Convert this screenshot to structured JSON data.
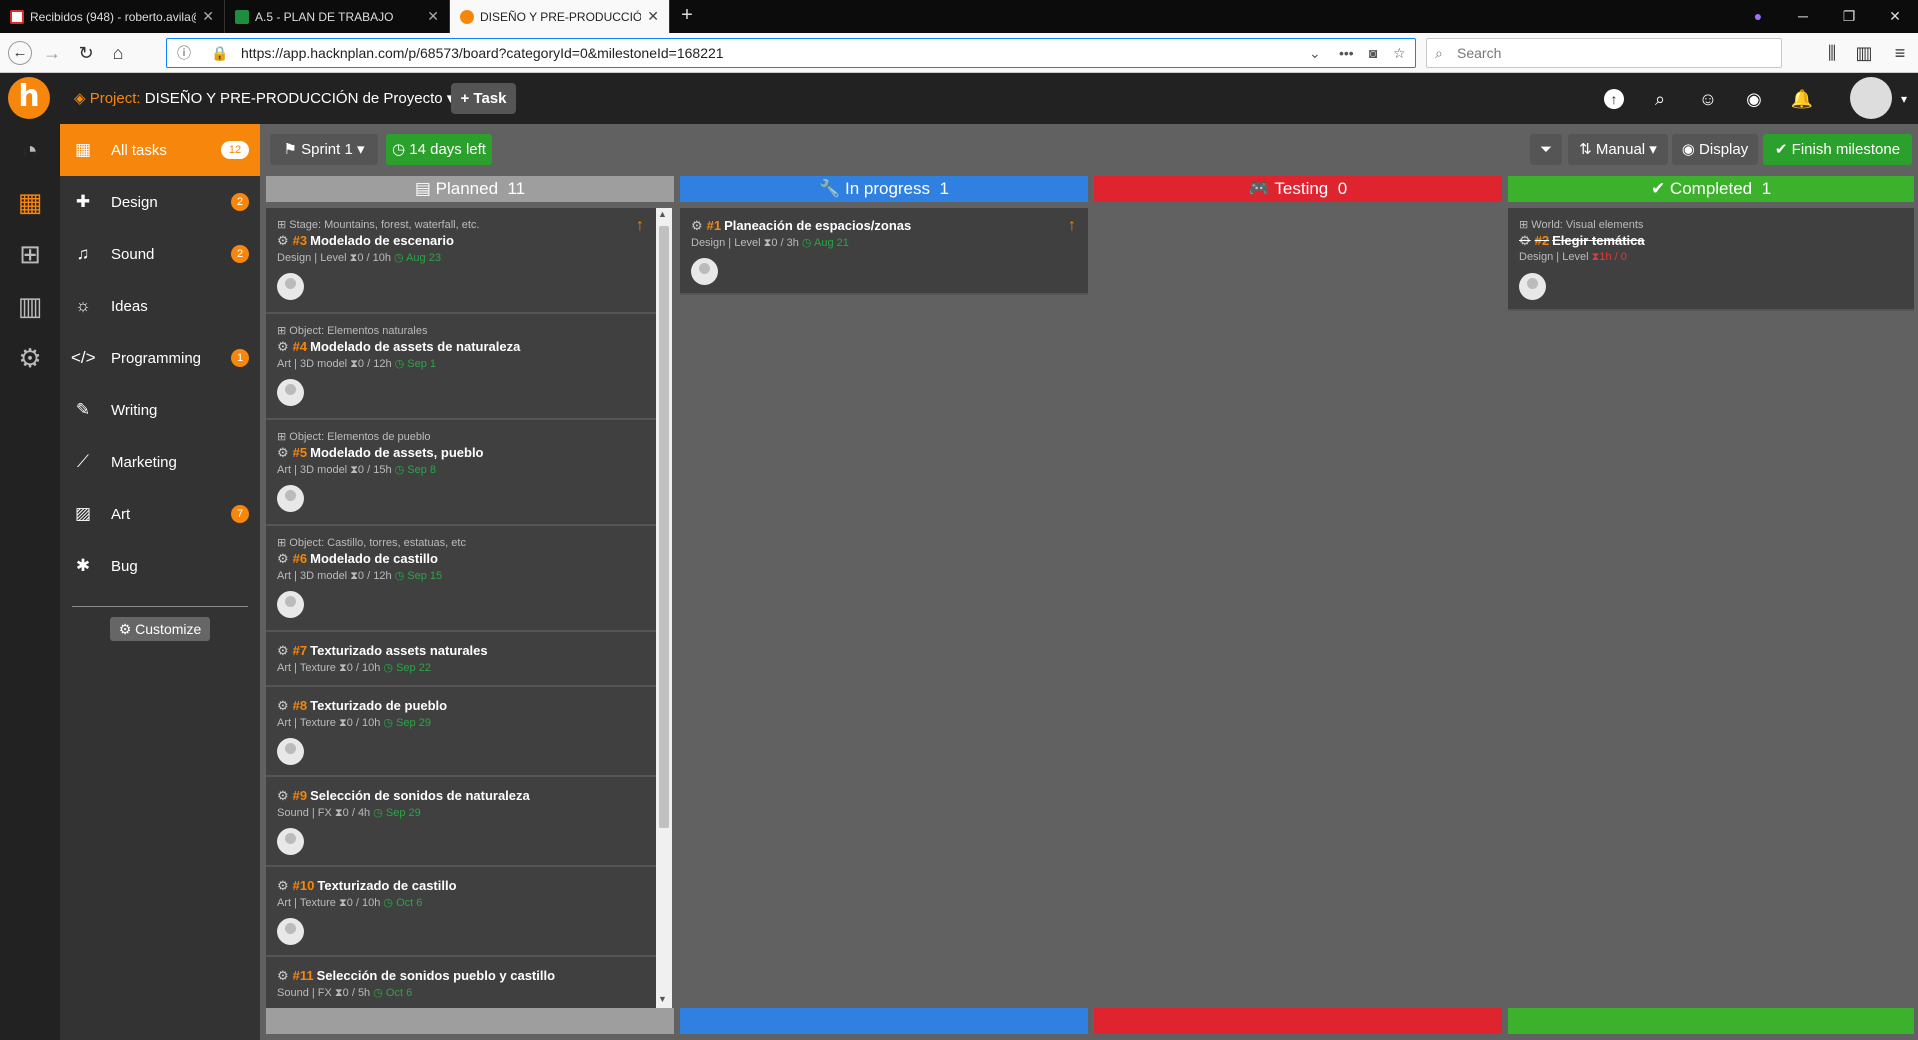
{
  "browser": {
    "tabs": [
      {
        "title": "Recibidos (948) - roberto.avila@",
        "fav_color": "#d93025"
      },
      {
        "title": "A.5 - PLAN DE TRABAJO",
        "fav_color": "#1e8e3e"
      },
      {
        "title": "DISEÑO Y PRE-PRODUCCIÓN d",
        "fav_color": "#f7860d"
      }
    ],
    "new_tab": "+",
    "url": "https://app.hacknplan.com/p/68573/board?categoryId=0&milestoneId=168221",
    "search_placeholder": "Search"
  },
  "header": {
    "logo": "h",
    "project_prefix": "Project:",
    "project_name": "DISEÑO Y PRE-PRODUCCIÓN de Proyecto",
    "task_button": "+ Task"
  },
  "sidebar": {
    "items": [
      {
        "label": "All tasks",
        "badge": "12",
        "icon": "grid-icon"
      },
      {
        "label": "Design",
        "badge": "2",
        "icon": "puzzle-icon"
      },
      {
        "label": "Sound",
        "badge": "2",
        "icon": "headphones-icon"
      },
      {
        "label": "Ideas",
        "badge": "",
        "icon": "lightbulb-icon"
      },
      {
        "label": "Programming",
        "badge": "1",
        "icon": "code-icon"
      },
      {
        "label": "Writing",
        "badge": "",
        "icon": "pencil-icon"
      },
      {
        "label": "Marketing",
        "badge": "",
        "icon": "line-chart-icon"
      },
      {
        "label": "Art",
        "badge": "7",
        "icon": "image-icon"
      },
      {
        "label": "Bug",
        "badge": "",
        "icon": "bug-icon"
      }
    ],
    "customize": "Customize"
  },
  "toolbar": {
    "sprint": "Sprint 1",
    "days_left": "14 days left",
    "sort": "Manual",
    "display": "Display",
    "finish": "Finish milestone"
  },
  "columns": [
    {
      "name": "Planned",
      "count": "11",
      "color": "#9e9e9e"
    },
    {
      "name": "In progress",
      "count": "1",
      "color": "#2f80e0"
    },
    {
      "name": "Testing",
      "count": "0",
      "color": "#e0242f"
    },
    {
      "name": "Completed",
      "count": "1",
      "color": "#3cb22c"
    }
  ],
  "cards": {
    "planned": [
      {
        "path": "Stage: Mountains, forest, waterfall, etc.",
        "num": "#3",
        "title": "Modelado de escenario",
        "cat": "Design",
        "type": "Level",
        "time": "0 / 10h",
        "due": "Aug 23",
        "priority": true
      },
      {
        "path": "Object: Elementos naturales",
        "num": "#4",
        "title": "Modelado de assets de naturaleza",
        "cat": "Art",
        "type": "3D model",
        "time": "0 / 12h",
        "due": "Sep 1"
      },
      {
        "path": "Object: Elementos de pueblo",
        "num": "#5",
        "title": "Modelado de assets, pueblo",
        "cat": "Art",
        "type": "3D model",
        "time": "0 / 15h",
        "due": "Sep 8"
      },
      {
        "path": "Object: Castillo, torres, estatuas, etc",
        "num": "#6",
        "title": "Modelado de castillo",
        "cat": "Art",
        "type": "3D model",
        "time": "0 / 12h",
        "due": "Sep 15"
      },
      {
        "path": "",
        "num": "#7",
        "title": "Texturizado assets naturales",
        "cat": "Art",
        "type": "Texture",
        "time": "0 / 10h",
        "due": "Sep 22"
      },
      {
        "path": "",
        "num": "#8",
        "title": "Texturizado de pueblo",
        "cat": "Art",
        "type": "Texture",
        "time": "0 / 10h",
        "due": "Sep 29"
      },
      {
        "path": "",
        "num": "#9",
        "title": "Selección de sonidos de naturaleza",
        "cat": "Sound",
        "type": "FX",
        "time": "0 / 4h",
        "due": "Sep 29"
      },
      {
        "path": "",
        "num": "#10",
        "title": "Texturizado de castillo",
        "cat": "Art",
        "type": "Texture",
        "time": "0 / 10h",
        "due": "Oct 6"
      },
      {
        "path": "",
        "num": "#11",
        "title": "Selección de sonidos pueblo y castillo",
        "cat": "Sound",
        "type": "FX",
        "time": "0 / 5h",
        "due": "Oct 6"
      }
    ],
    "in_progress": [
      {
        "num": "#1",
        "title": "Planeación de espacios/zonas",
        "cat": "Design",
        "type": "Level",
        "time": "0 / 3h",
        "due": "Aug 21"
      }
    ],
    "completed": [
      {
        "path": "World: Visual elements",
        "num": "#2",
        "title": "Elegir temática",
        "cat": "Design",
        "type": "Level",
        "time": "1h / 0"
      }
    ]
  }
}
